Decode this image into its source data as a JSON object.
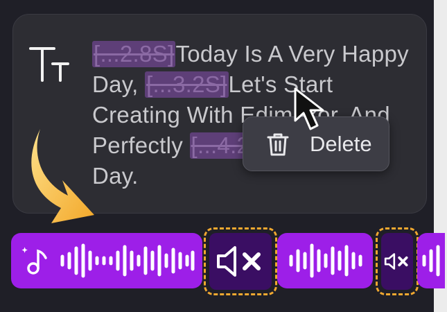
{
  "subtitle": {
    "p1": "[...2.8S]",
    "t1": "Today Is A Very Happy Day, ",
    "p2": "[...3.2S]",
    "t2": "Let's Start Creating With Edimakor. And Perfectly ",
    "p3": "[...4.2S]",
    "t3": " Wonderful Day."
  },
  "context_menu": {
    "delete_label": "Delete"
  },
  "icons": {
    "text": "text-size-icon",
    "trash": "trash-icon",
    "cursor": "mouse-pointer-icon",
    "arrow": "curved-arrow-icon",
    "music": "music-note-icon",
    "mute": "speaker-mute-icon"
  },
  "colors": {
    "track": "#9d1fe8",
    "muted_segment": "#3a0e63",
    "highlight_border": "#f0a830",
    "pause_tag": "#5e3f78",
    "arrow": "#f5b63a"
  }
}
